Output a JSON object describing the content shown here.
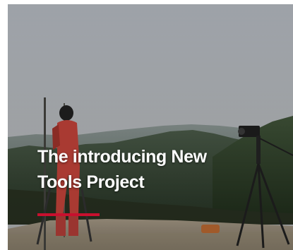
{
  "card": {
    "title_line1": "The introducing New",
    "title_line2": "Tools Project",
    "accent_color": "#c8102e",
    "image_subject": "surveyor-with-theodolite-on-hilltop"
  }
}
